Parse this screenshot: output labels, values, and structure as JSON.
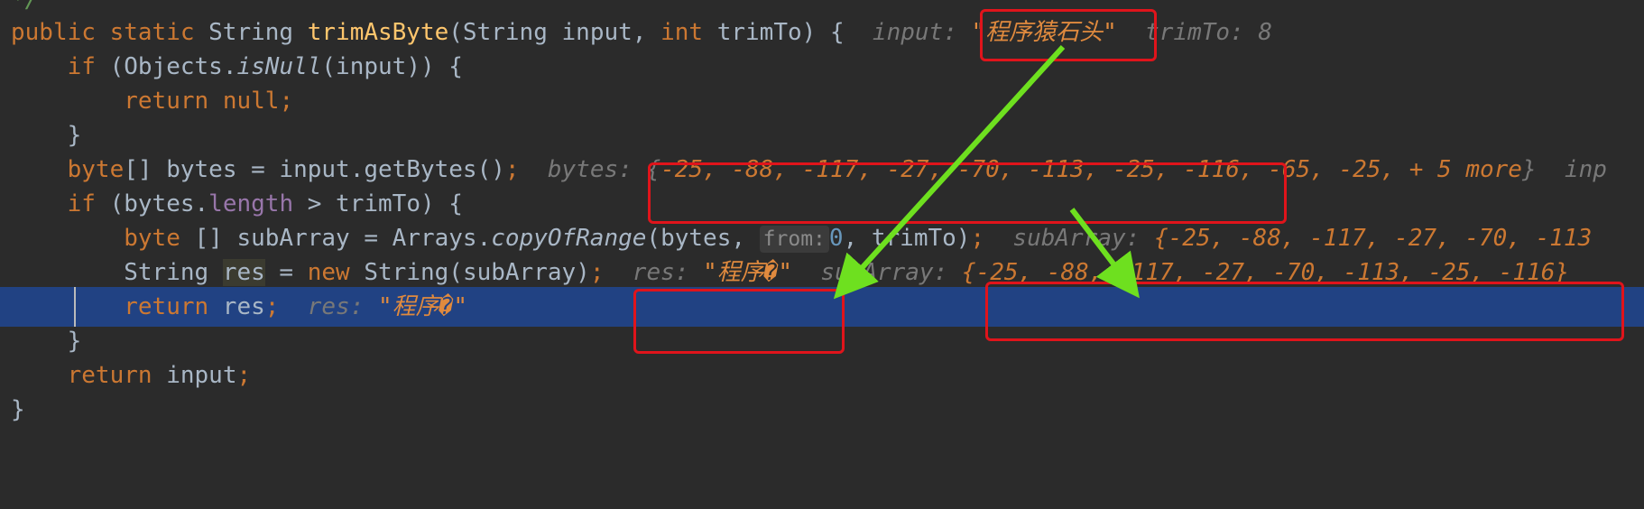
{
  "code": {
    "comment_end": "*/",
    "l1": {
      "public": "public",
      "static": "static",
      "type_string": "String",
      "method": "trimAsByte",
      "params": "(String input, ",
      "int": "int",
      "param2": " trimTo) {",
      "hint_input_label": "input: ",
      "hint_input_value": "\"程序猿石头\"",
      "hint_trim_label": "trimTo: ",
      "hint_trim_value": "8"
    },
    "l2": {
      "if": "if",
      "pre": " (Objects.",
      "method": "isNull",
      "post": "(input)) {"
    },
    "l3": {
      "return": "return",
      "null": "null",
      "semi": ";"
    },
    "l4": {
      "brace": "}"
    },
    "l5": {
      "byte": "byte",
      "rest": "[] bytes = input.getBytes()",
      "semi": ";",
      "hint_label": "bytes: ",
      "open": "{",
      "values": "-25, -88, -117, -27, -70, -113, -25, -116, -65, -25, + 5 more",
      "close": "}",
      "trailing": "inp"
    },
    "l6": {
      "if": "if",
      "pre": " (bytes.",
      "field": "length",
      "post": " > trimTo) {"
    },
    "l7": {
      "byte": "byte",
      "pre": " [] subArray = Arrays.",
      "method": "copyOfRange",
      "args1": "(bytes, ",
      "param_hint": "from:",
      "zero": "0",
      "args2": ", trimTo)",
      "semi": ";",
      "hint_label": "subArray: ",
      "hint_value": "{-25, -88, -117, -27, -70, -113"
    },
    "l8": {
      "type": "String",
      "var": "res",
      "eq": " = ",
      "new": "new",
      "rest": " String(subArray)",
      "semi": ";",
      "hint_res_label": "res: ",
      "hint_res_value": "\"程序�\"",
      "hint_sub_label": "subArray: ",
      "hint_sub_value": "{-25, -88, -117, -27, -70, -113, -25, -116}"
    },
    "l9": {
      "return": "return",
      "var": " res",
      "semi": ";",
      "hint_label": "res: ",
      "hint_value": "\"程序�\""
    },
    "l10": {
      "brace": "}"
    },
    "l11": {
      "return": "return",
      "var": " input",
      "semi": ";"
    },
    "l12": {
      "brace": "}"
    }
  },
  "colors": {
    "background": "#2b2b2b",
    "current_line": "#214283",
    "keyword": "#cc7832",
    "method": "#ffc66d",
    "annotation_box": "#e0141b",
    "arrow": "#6ee01f"
  }
}
